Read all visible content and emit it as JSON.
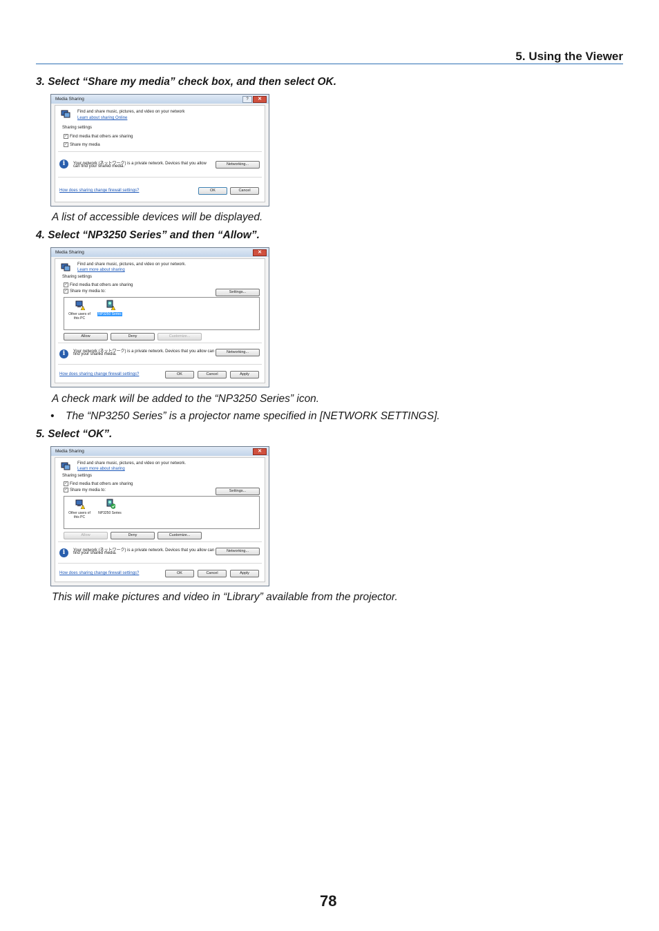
{
  "header": {
    "title": "5. Using the Viewer"
  },
  "steps": {
    "s3": "3. Select “Share my media” check box, and then select OK.",
    "s4": "4. Select “NP3250 Series” and then “Allow”.",
    "s5": "5. Select “OK”."
  },
  "notes": {
    "n1": "A list of accessible devices will be displayed.",
    "n2": "A check mark will be added to the “NP3250 Series” icon.",
    "bullet_mark": "•",
    "bullet": "The “NP3250 Series” is a projector name specified in [NETWORK SETTINGS].",
    "n3": "This will make pictures and video in “Library” available from the projector."
  },
  "page_number": "78",
  "dialog1": {
    "title": "Media Sharing",
    "help": "?",
    "close": "✕",
    "intro": "Find and share music, pictures, and video on your network",
    "learn": "Learn about sharing Online",
    "settings_label": "Sharing settings",
    "cb1": "Find media that others are sharing",
    "cb2": "Share my media",
    "check": "✓",
    "info_i": "i",
    "net1": "Your network (ネットワーク) is a private network. Devices that you allow",
    "net2": "can find your shared media.",
    "networking": "Networking...",
    "firewall": "How does sharing change firewall settings?",
    "ok": "OK",
    "cancel": "Cancel"
  },
  "dialog2": {
    "title": "Media Sharing",
    "close": "✕",
    "intro": "Find and share music, pictures, and video on your network.",
    "learn": "Learn more about sharing",
    "settings_label": "Sharing settings",
    "cb1": "Find media that others are sharing",
    "cb2": "Share my media to:",
    "check": "✓",
    "settings": "Settings...",
    "dev1a": "Other users of",
    "dev1b": "this PC",
    "dev2": "NP3250 Series",
    "allow": "Allow",
    "deny": "Deny",
    "customize": "Customize...",
    "info_i": "i",
    "net1": "Your network (ネットワーク) is a private network. Devices that you allow can",
    "net2": "find your shared media.",
    "networking": "Networking...",
    "firewall": "How does sharing change firewall settings?",
    "ok": "OK",
    "cancel": "Cancel",
    "apply": "Apply"
  },
  "dialog3": {
    "title": "Media Sharing",
    "close": "✕",
    "intro": "Find and share music, pictures, and video on your network.",
    "learn": "Learn more about sharing",
    "settings_label": "Sharing settings",
    "cb1": "Find media that others are sharing",
    "cb2": "Share my media to:",
    "check": "✓",
    "settings": "Settings...",
    "dev1a": "Other users of",
    "dev1b": "this PC",
    "dev2": "NP3250 Series",
    "allow": "Allow",
    "deny": "Deny",
    "customize": "Customize...",
    "info_i": "i",
    "net1": "Your network (ネットワーク) is a private network. Devices that you allow can",
    "net2": "find your shared media.",
    "networking": "Networking...",
    "firewall": "How does sharing change firewall settings?",
    "ok": "OK",
    "cancel": "Cancel",
    "apply": "Apply"
  }
}
